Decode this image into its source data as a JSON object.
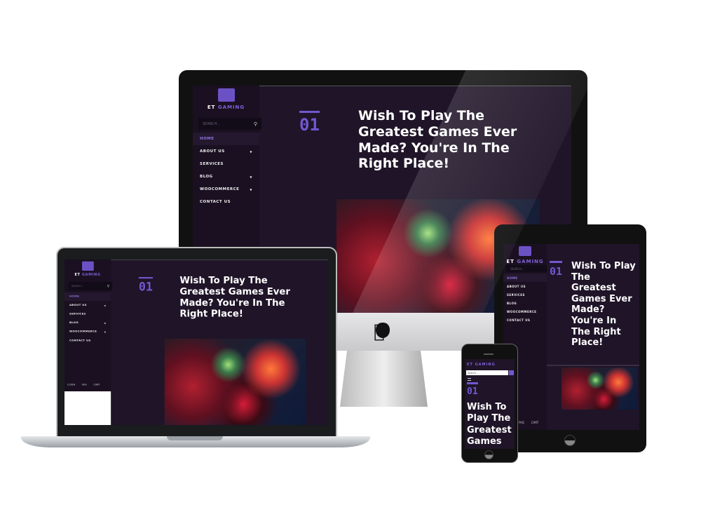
{
  "site": {
    "logo": {
      "brand_a": "ET",
      "brand_b": "GAMING"
    },
    "search_placeholder": "SEARCH...",
    "mobile_search_placeholder": "Search ...",
    "nav": [
      {
        "label": "HOME",
        "active": true,
        "submenu": false
      },
      {
        "label": "ABOUT US",
        "active": false,
        "submenu": true
      },
      {
        "label": "SERVICES",
        "active": false,
        "submenu": false
      },
      {
        "label": "BLOG",
        "active": false,
        "submenu": true
      },
      {
        "label": "WOOCOMMERCE",
        "active": false,
        "submenu": true
      },
      {
        "label": "CONTACT US",
        "active": false,
        "submenu": false
      }
    ],
    "footer_links": [
      "LOGIN",
      "FAQ",
      "CART"
    ],
    "hero": {
      "number": "01",
      "title": "Wish To Play The Greatest Games Ever Made? You're In The Right Place!"
    },
    "phone_title": "Wish To Play The Greatest Games"
  },
  "colors": {
    "accent": "#6b52c4",
    "background": "#1f1428",
    "sidebar": "#1a1021"
  },
  "icons": {
    "search": "search-icon",
    "apple": "apple-logo-icon",
    "menu": "hamburger-menu-icon"
  }
}
